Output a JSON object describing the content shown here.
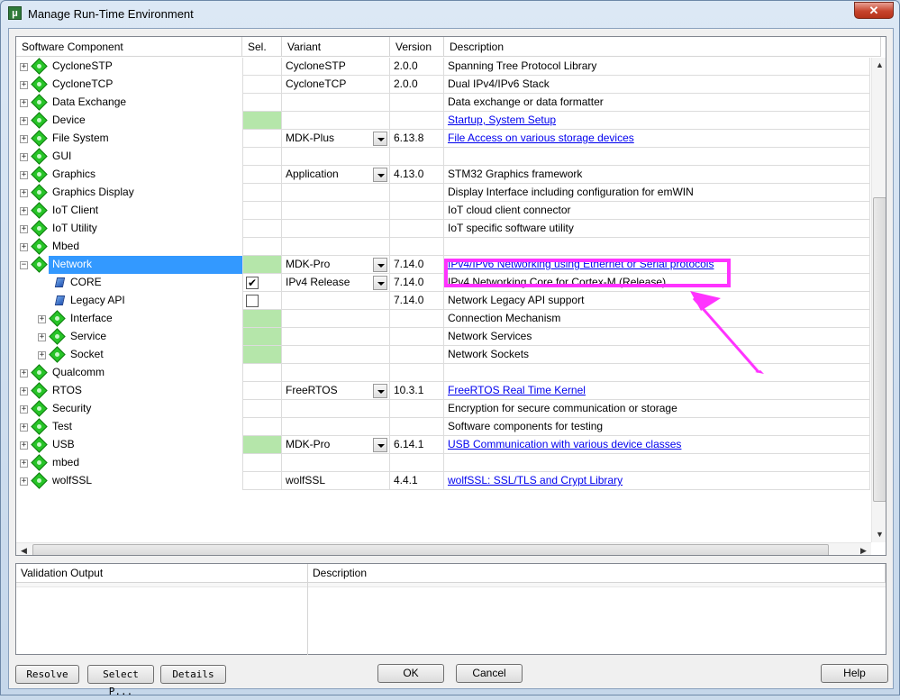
{
  "window": {
    "title": "Manage Run-Time Environment",
    "close_glyph": "✕"
  },
  "columns": {
    "component": "Software Component",
    "sel": "Sel.",
    "variant": "Variant",
    "version": "Version",
    "description": "Description"
  },
  "rows": [
    {
      "name": "CycloneSTP",
      "sel": "",
      "variant": "CycloneSTP",
      "version": "2.0.0",
      "desc": "Spanning Tree Protocol Library"
    },
    {
      "name": "CycloneTCP",
      "sel": "",
      "variant": "CycloneTCP",
      "version": "2.0.0",
      "desc": "Dual IPv4/IPv6 Stack"
    },
    {
      "name": "Data Exchange",
      "sel": "",
      "variant": "",
      "version": "",
      "desc": "Data exchange or data formatter"
    },
    {
      "name": "Device",
      "sel": "",
      "variant": "",
      "version": "",
      "desc": "Startup, System Setup"
    },
    {
      "name": "File System",
      "sel": "",
      "variant": "MDK-Plus",
      "version": "6.13.8",
      "desc": "File Access on various storage devices"
    },
    {
      "name": "GUI",
      "sel": "",
      "variant": "",
      "version": "",
      "desc": ""
    },
    {
      "name": "Graphics",
      "sel": "",
      "variant": "Application",
      "version": "4.13.0",
      "desc": "STM32 Graphics framework"
    },
    {
      "name": "Graphics Display",
      "sel": "",
      "variant": "",
      "version": "",
      "desc": "Display Interface including configuration for emWIN"
    },
    {
      "name": "IoT Client",
      "sel": "",
      "variant": "",
      "version": "",
      "desc": "IoT cloud client connector"
    },
    {
      "name": "IoT Utility",
      "sel": "",
      "variant": "",
      "version": "",
      "desc": "IoT specific software utility"
    },
    {
      "name": "Mbed",
      "sel": "",
      "variant": "",
      "version": "",
      "desc": ""
    },
    {
      "name": "Network",
      "sel": "",
      "variant": "MDK-Pro",
      "version": "7.14.0",
      "desc": "IPv4/IPv6 Networking using Ethernet or Serial protocols"
    },
    {
      "name": "CORE",
      "sel": "✔",
      "variant": "IPv4 Release",
      "version": "7.14.0",
      "desc": "IPv4 Networking Core for Cortex-M (Release)"
    },
    {
      "name": "Legacy API",
      "sel": "",
      "variant": "",
      "version": "7.14.0",
      "desc": "Network Legacy API support"
    },
    {
      "name": "Interface",
      "sel": "",
      "variant": "",
      "version": "",
      "desc": "Connection Mechanism"
    },
    {
      "name": "Service",
      "sel": "",
      "variant": "",
      "version": "",
      "desc": "Network Services"
    },
    {
      "name": "Socket",
      "sel": "",
      "variant": "",
      "version": "",
      "desc": "Network Sockets"
    },
    {
      "name": "Qualcomm",
      "sel": "",
      "variant": "",
      "version": "",
      "desc": ""
    },
    {
      "name": "RTOS",
      "sel": "",
      "variant": "FreeRTOS",
      "version": "10.3.1",
      "desc": "FreeRTOS Real Time Kernel"
    },
    {
      "name": "Security",
      "sel": "",
      "variant": "",
      "version": "",
      "desc": "Encryption for secure communication or storage"
    },
    {
      "name": "Test",
      "sel": "",
      "variant": "",
      "version": "",
      "desc": "Software components for testing"
    },
    {
      "name": "USB",
      "sel": "",
      "variant": "MDK-Pro",
      "version": "6.14.1",
      "desc": "USB Communication with various device classes"
    },
    {
      "name": "mbed",
      "sel": "",
      "variant": "",
      "version": "",
      "desc": ""
    },
    {
      "name": "wolfSSL",
      "sel": "",
      "variant": "wolfSSL",
      "version": "4.4.1",
      "desc": "wolfSSL: SSL/TLS and Crypt Library"
    }
  ],
  "scroll_glyphs": {
    "up": "▲",
    "down": "▼",
    "left": "◀",
    "right": "▶"
  },
  "tree_glyphs": {
    "expand": "+",
    "collapse": "−"
  },
  "validation": {
    "col_output": "Validation Output",
    "col_desc": "Description"
  },
  "buttons": {
    "resolve": "Resolve",
    "select_packs": "Select P...",
    "details": "Details",
    "ok": "OK",
    "cancel": "Cancel",
    "help": "Help"
  },
  "colors": {
    "selection": "#3399ff",
    "selected_green": "#b5e6aa",
    "annotation": "#ff33ff",
    "link": "#0000ee"
  }
}
